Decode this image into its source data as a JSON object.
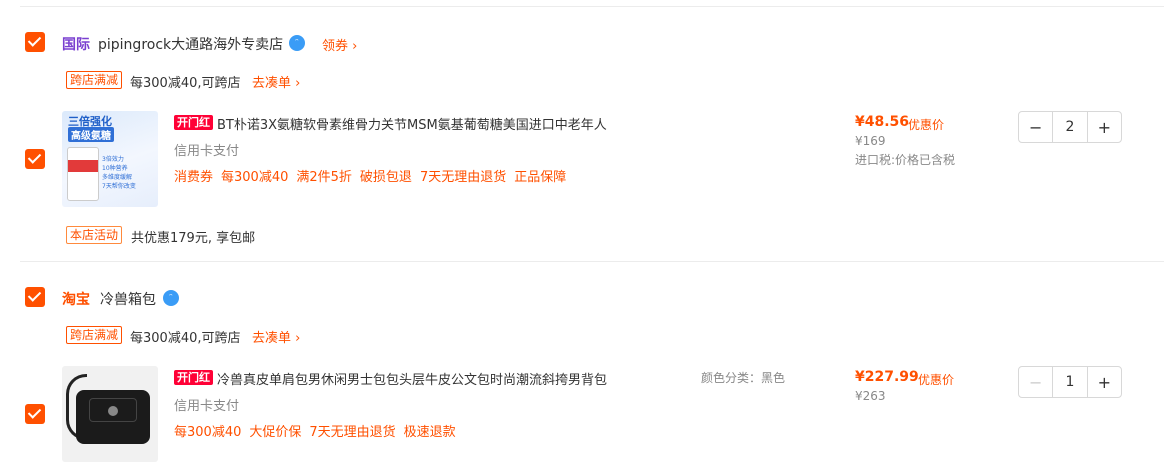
{
  "stores": [
    {
      "region_tag": "国际",
      "name": "pipingrock大通路海外专卖店",
      "coupon_link": "领券 ›",
      "promo": {
        "tag": "跨店满减",
        "text": "每300减40,可跨店",
        "link": "去凑单 ›"
      },
      "item": {
        "image_text_1": "三倍强化",
        "image_text_2": "高级氨糖",
        "image_points": [
          "3倍效力",
          "10种营养",
          "多维度缓解",
          "7天帮你改变"
        ],
        "badge": "开门红",
        "title": "BT朴诺3X氨糖软骨素维骨力关节MSM氨基葡萄糖美国进口中老年人",
        "payment": "信用卡支付",
        "services": [
          "消费券",
          "每300减40",
          "满2件5折",
          "破损包退",
          "7天无理由退货",
          "正品保障"
        ],
        "price": "¥48.56",
        "price_label": "优惠价",
        "original_price": "¥169",
        "tax_note": "进口税:价格已含税",
        "quantity": "2",
        "minus": "−",
        "plus": "+"
      },
      "activity": {
        "tag": "本店活动",
        "text": "共优惠179元, 享包邮"
      }
    },
    {
      "region_tag": "淘宝",
      "name": "冷兽箱包",
      "promo": {
        "tag": "跨店满减",
        "text": "每300减40,可跨店",
        "link": "去凑单 ›"
      },
      "item": {
        "badge": "开门红",
        "title": "冷兽真皮单肩包男休闲男士包包头层牛皮公文包时尚潮流斜挎男背包",
        "payment": "信用卡支付",
        "services": [
          "每300减40",
          "大促价保",
          "7天无理由退货",
          "极速退款"
        ],
        "spec": "颜色分类：黑色",
        "price": "¥227.99",
        "price_label": "优惠价",
        "original_price": "¥263",
        "quantity": "1",
        "minus": "−",
        "plus": "+"
      }
    }
  ],
  "colors": {
    "accent": "#ff5000",
    "badge": "#ff0036",
    "region_purple": "#7a3fd0"
  }
}
